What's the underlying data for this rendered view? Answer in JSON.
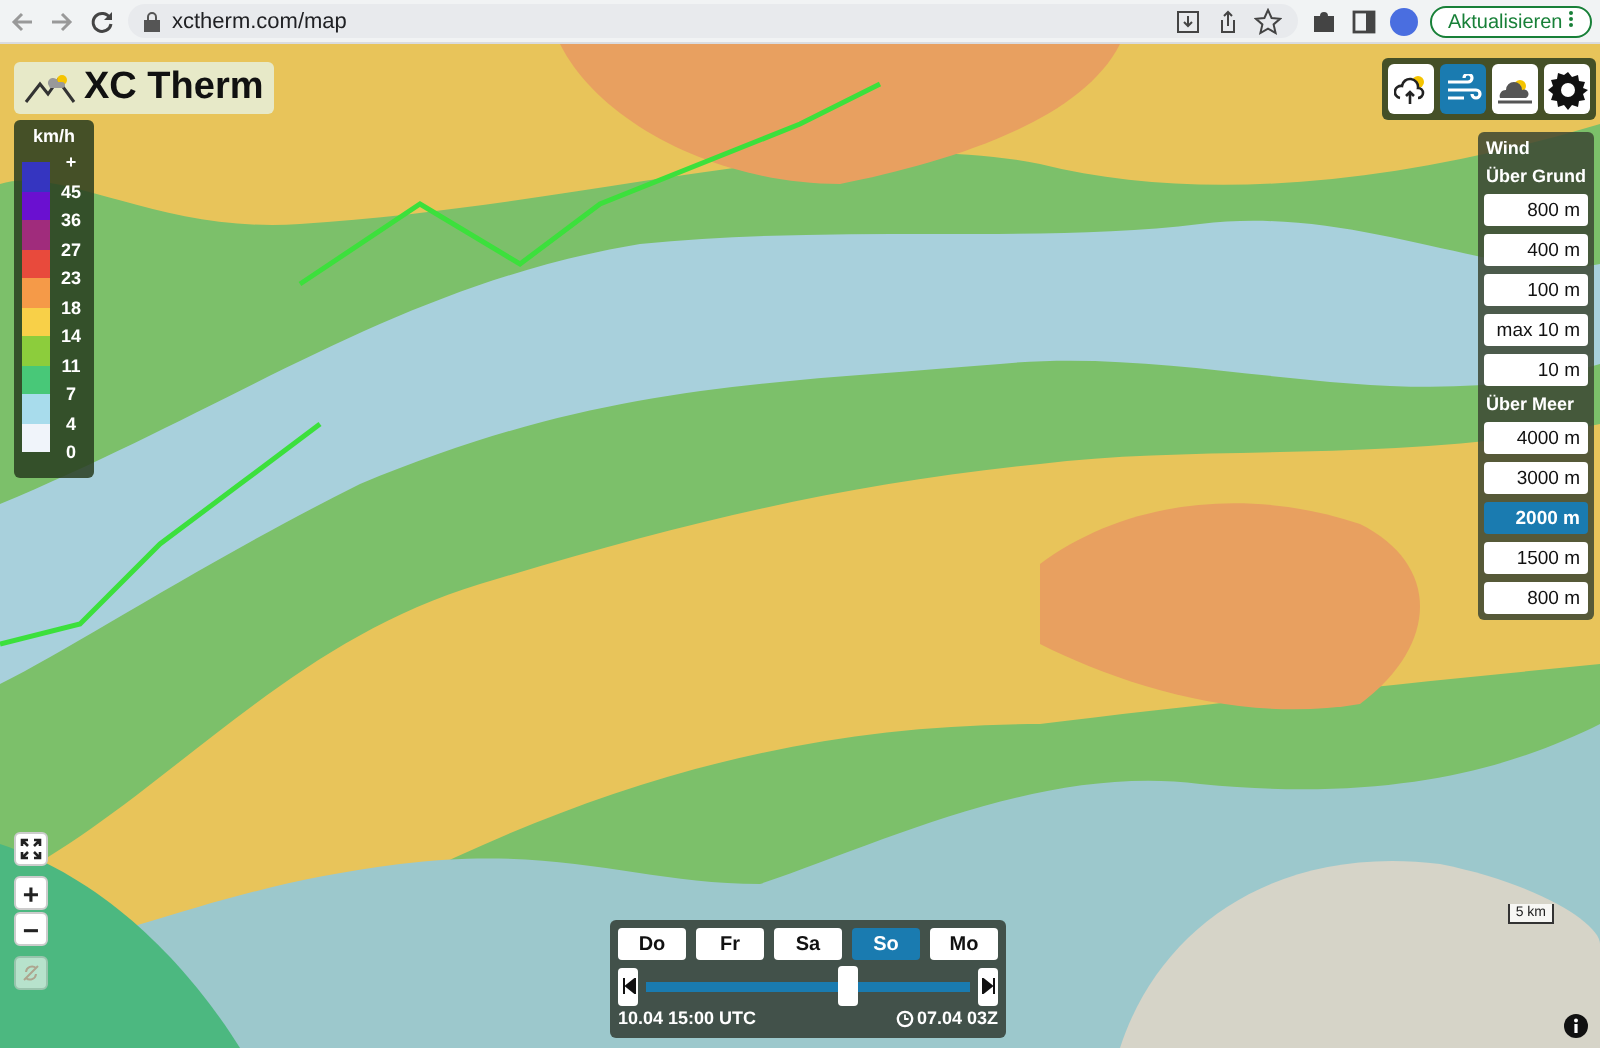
{
  "browser": {
    "url": "xctherm.com/map",
    "update_button": "Aktualisieren"
  },
  "logo": {
    "text": "XC Therm"
  },
  "legend": {
    "unit": "km/h",
    "swatches": [
      {
        "color": "#3535c0"
      },
      {
        "color": "#6a10d0"
      },
      {
        "color": "#a02c7c"
      },
      {
        "color": "#e84a3c"
      },
      {
        "color": "#f59a48"
      },
      {
        "color": "#f8d048"
      },
      {
        "color": "#8ccd3c"
      },
      {
        "color": "#48c878"
      },
      {
        "color": "#a8dcec"
      },
      {
        "color": "#f0f4fa"
      }
    ],
    "labels": [
      "+",
      "45",
      "36",
      "27",
      "23",
      "18",
      "14",
      "11",
      "7",
      "4",
      "0"
    ]
  },
  "toolbar": [
    {
      "kind": "thermal",
      "selected": false
    },
    {
      "kind": "wind",
      "selected": true
    },
    {
      "kind": "cloudbase",
      "selected": false
    },
    {
      "kind": "settings",
      "selected": false
    }
  ],
  "wind_panel": {
    "title": "Wind",
    "groups": [
      {
        "label": "Über Grund",
        "options": [
          {
            "label": "800 m",
            "selected": false
          },
          {
            "label": "400 m",
            "selected": false
          },
          {
            "label": "100 m",
            "selected": false
          },
          {
            "label": "max 10 m",
            "selected": false
          },
          {
            "label": "10 m",
            "selected": false
          }
        ]
      },
      {
        "label": "Über Meer",
        "options": [
          {
            "label": "4000 m",
            "selected": false
          },
          {
            "label": "3000 m",
            "selected": false
          },
          {
            "label": "2000 m",
            "selected": true
          },
          {
            "label": "1500 m",
            "selected": false
          },
          {
            "label": "800 m",
            "selected": false
          }
        ]
      }
    ]
  },
  "timeline": {
    "days": [
      {
        "label": "Do",
        "selected": false
      },
      {
        "label": "Fr",
        "selected": false
      },
      {
        "label": "Sa",
        "selected": false
      },
      {
        "label": "So",
        "selected": true
      },
      {
        "label": "Mo",
        "selected": false
      }
    ],
    "level": 0.63,
    "time": "10.04 15:00 UTC",
    "run": "07.04 03Z"
  },
  "map_controls": {
    "zoom_in": "+",
    "zoom_out": "−",
    "location_disabled": true
  },
  "scale": "5 km"
}
